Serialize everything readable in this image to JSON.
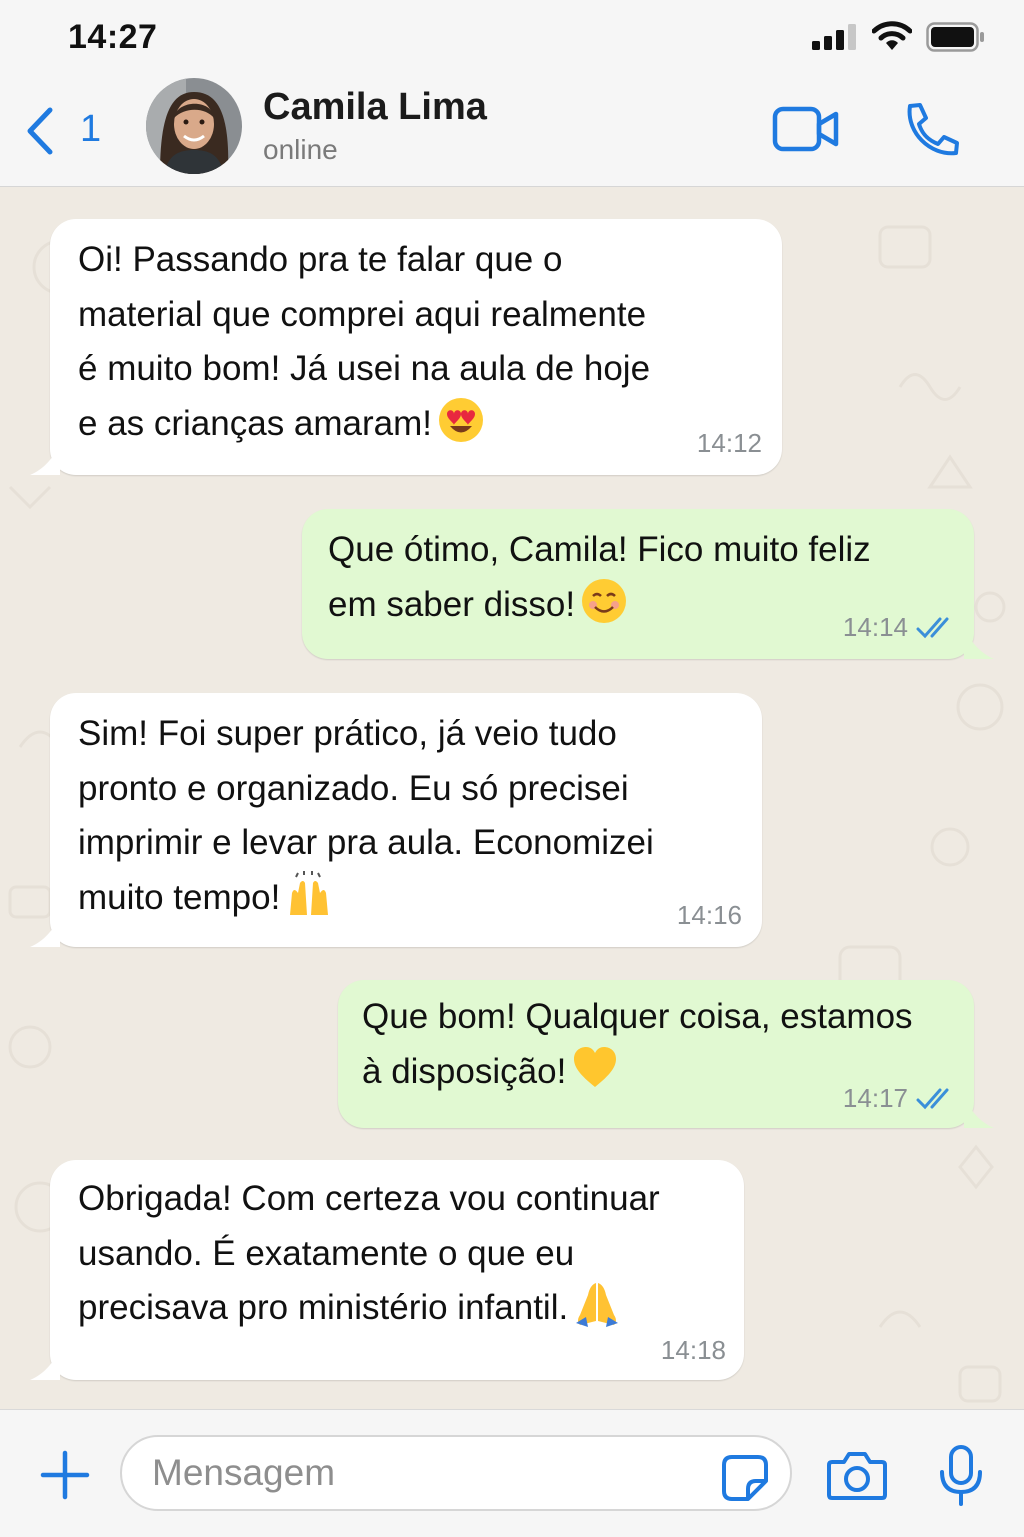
{
  "status_bar": {
    "time": "14:27"
  },
  "header": {
    "back_count": "1",
    "contact_name": "Camila Lima",
    "contact_status": "online"
  },
  "messages": [
    {
      "direction": "incoming",
      "lines": [
        "Oi! Passando pra te falar que o",
        "material que comprei aqui realmente",
        "é muito bom! Já usei na aula de hoje",
        "e as crianças amaram!"
      ],
      "emoji": "heart-eyes-emoji",
      "time": "14:12"
    },
    {
      "direction": "outgoing",
      "lines": [
        "Que ótimo, Camila! Fico muito feliz",
        "em saber disso!"
      ],
      "emoji": "smiling-emoji",
      "time": "14:14",
      "read": true
    },
    {
      "direction": "incoming",
      "lines": [
        "Sim! Foi super prático, já veio tudo",
        "pronto e organizado. Eu só precisei",
        "imprimir e levar pra aula. Economizei",
        "muito tempo!"
      ],
      "emoji": "raising-hands-emoji",
      "time": "14:16"
    },
    {
      "direction": "outgoing",
      "lines": [
        "Que bom! Qualquer coisa, estamos",
        "à disposição!"
      ],
      "emoji": "yellow-heart-emoji",
      "time": "14:17",
      "read": true
    },
    {
      "direction": "incoming",
      "lines": [
        "Obrigada! Com certeza vou continuar",
        "usando. É exatamente o que eu",
        "precisava pro ministério infantil."
      ],
      "emoji": "folded-hands-emoji",
      "time": "14:18"
    }
  ],
  "composer": {
    "placeholder": "Mensagem"
  },
  "colors": {
    "accent": "#1f7ae0",
    "incoming_bubble": "#ffffff",
    "outgoing_bubble": "#e1f9d2",
    "chat_background": "#efeae2",
    "read_ticks": "#3b8fd9"
  }
}
